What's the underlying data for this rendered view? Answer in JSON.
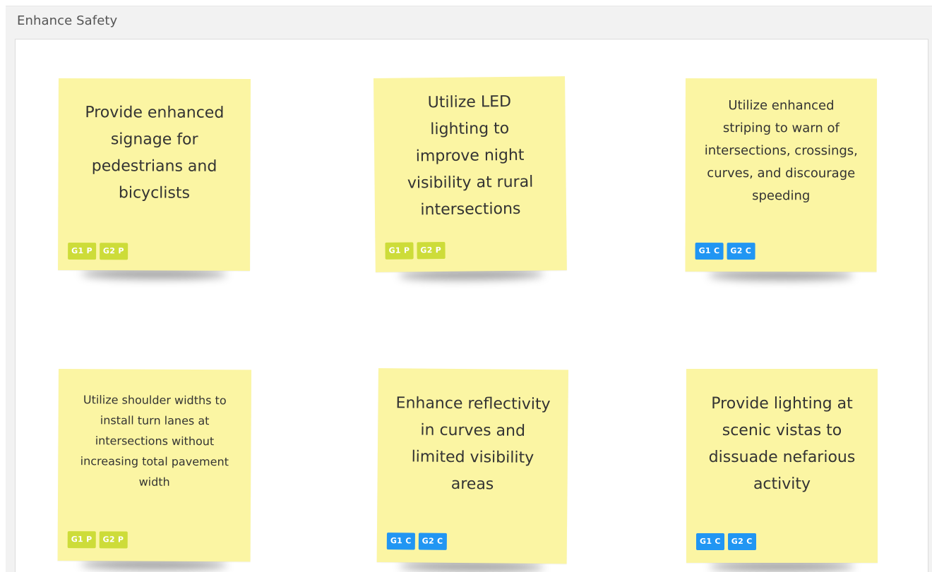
{
  "section": {
    "title": "Enhance Safety"
  },
  "colors": {
    "note": "#fbf5a3",
    "tag_p": "#cddc39",
    "tag_c": "#2196f3"
  },
  "notes": [
    {
      "text": "Provide enhanced signage for pedestrians and bicyclists",
      "tags": [
        "G1 P",
        "G2 P"
      ]
    },
    {
      "text": "Utilize LED lighting to improve night visibility at rural intersections",
      "tags": [
        "G1 P",
        "G2 P"
      ]
    },
    {
      "text": "Utilize enhanced striping to warn of intersections, crossings, curves, and discourage speeding",
      "tags": [
        "G1 C",
        "G2 C"
      ]
    },
    {
      "text": "Utilize shoulder widths to install turn lanes at intersections without increasing total pavement width",
      "tags": [
        "G1 P",
        "G2 P"
      ]
    },
    {
      "text": "Enhance reflectivity in curves and limited visibility areas",
      "tags": [
        "G1 C",
        "G2 C"
      ]
    },
    {
      "text": "Provide lighting at scenic vistas to dissuade nefarious activity",
      "tags": [
        "G1 C",
        "G2 C"
      ]
    }
  ]
}
